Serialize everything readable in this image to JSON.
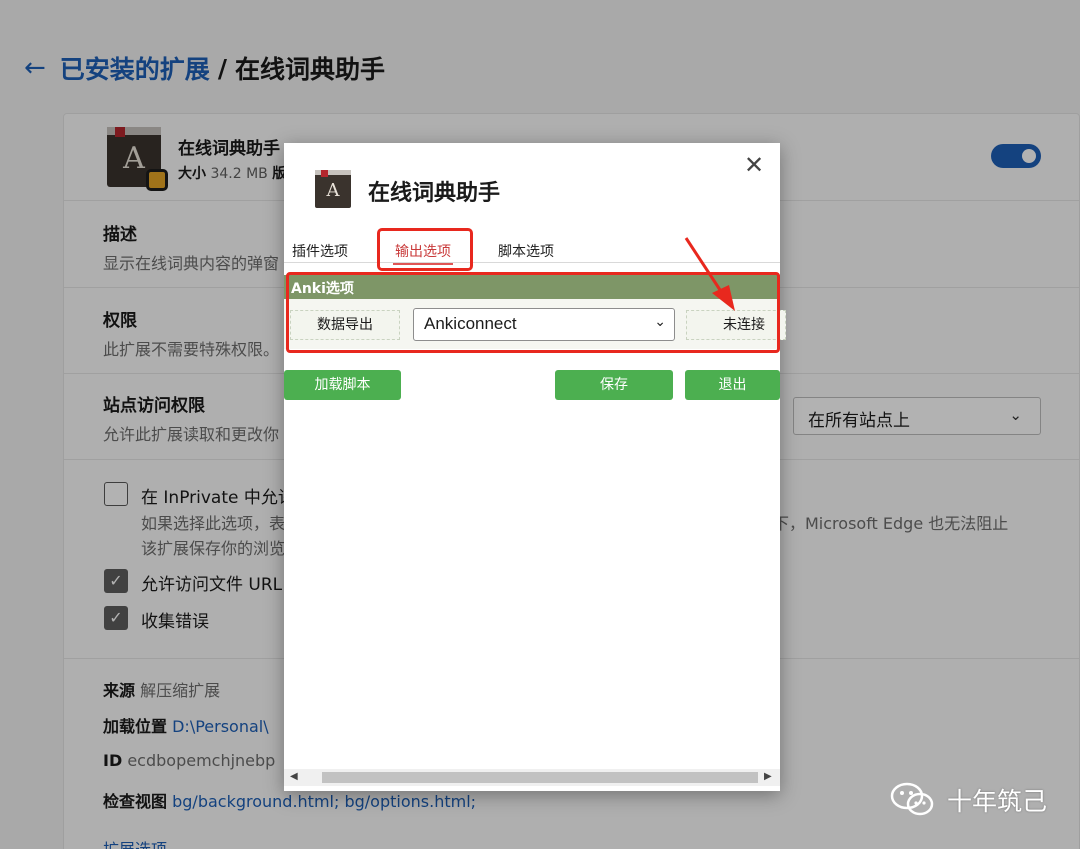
{
  "breadcrumb": {
    "back_icon": "arrow-left-icon",
    "parent": "已安装的扩展",
    "separator": "/",
    "current": "在线词典助手"
  },
  "extension": {
    "name": "在线词典助手",
    "size_label": "大小",
    "size_value": "34.2 MB",
    "size_trailing": "版",
    "enabled": true
  },
  "sections": {
    "description": {
      "title": "描述",
      "text": "显示在线词典内容的弹窗"
    },
    "permissions": {
      "title": "权限",
      "text": "此扩展不需要特殊权限。"
    },
    "site_access": {
      "title": "站点访问权限",
      "text": "允许此扩展读取和更改你",
      "select_value": "在所有站点上"
    }
  },
  "options": {
    "inprivate": {
      "label": "在 InPrivate 中允许",
      "checked": false
    },
    "inprivate_note_1_left": "如果选择此选项，表",
    "inprivate_note_1_right": "下，Microsoft Edge 也无法阻止",
    "inprivate_note_2": "该扩展保存你的浏览",
    "file_urls": {
      "label": "允许访问文件 URL",
      "checked": true
    },
    "collect_errors": {
      "label": "收集错误",
      "checked": true
    }
  },
  "details": {
    "source_label": "来源",
    "source_value": "解压缩扩展",
    "load_label": "加载位置",
    "load_value": "D:\\Personal\\",
    "id_label": "ID",
    "id_value": "ecdbopemchjnebp",
    "inspect_label": "检查视图",
    "inspect_value_1": "bg/background.html;",
    "inspect_value_2": "bg/options.html;",
    "ext_options": "扩展选项"
  },
  "popup": {
    "title": "在线词典助手",
    "close_icon": "close-icon",
    "tabs": [
      "插件选项",
      "输出选项",
      "脚本选项"
    ],
    "active_tab": "输出选项",
    "anki": {
      "header": "Anki选项",
      "export_label": "数据导出",
      "format_value": "Ankiconnect",
      "status": "未连接"
    },
    "buttons": {
      "load_script": "加载脚本",
      "save": "保存",
      "exit": "退出"
    }
  },
  "watermark": {
    "icon": "wechat-icon",
    "text": "十年筑己"
  },
  "colors": {
    "accent_blue": "#1d5fb6",
    "green_button": "#4caf50",
    "anki_header": "#7e9667",
    "highlight_red": "#e8281e"
  }
}
